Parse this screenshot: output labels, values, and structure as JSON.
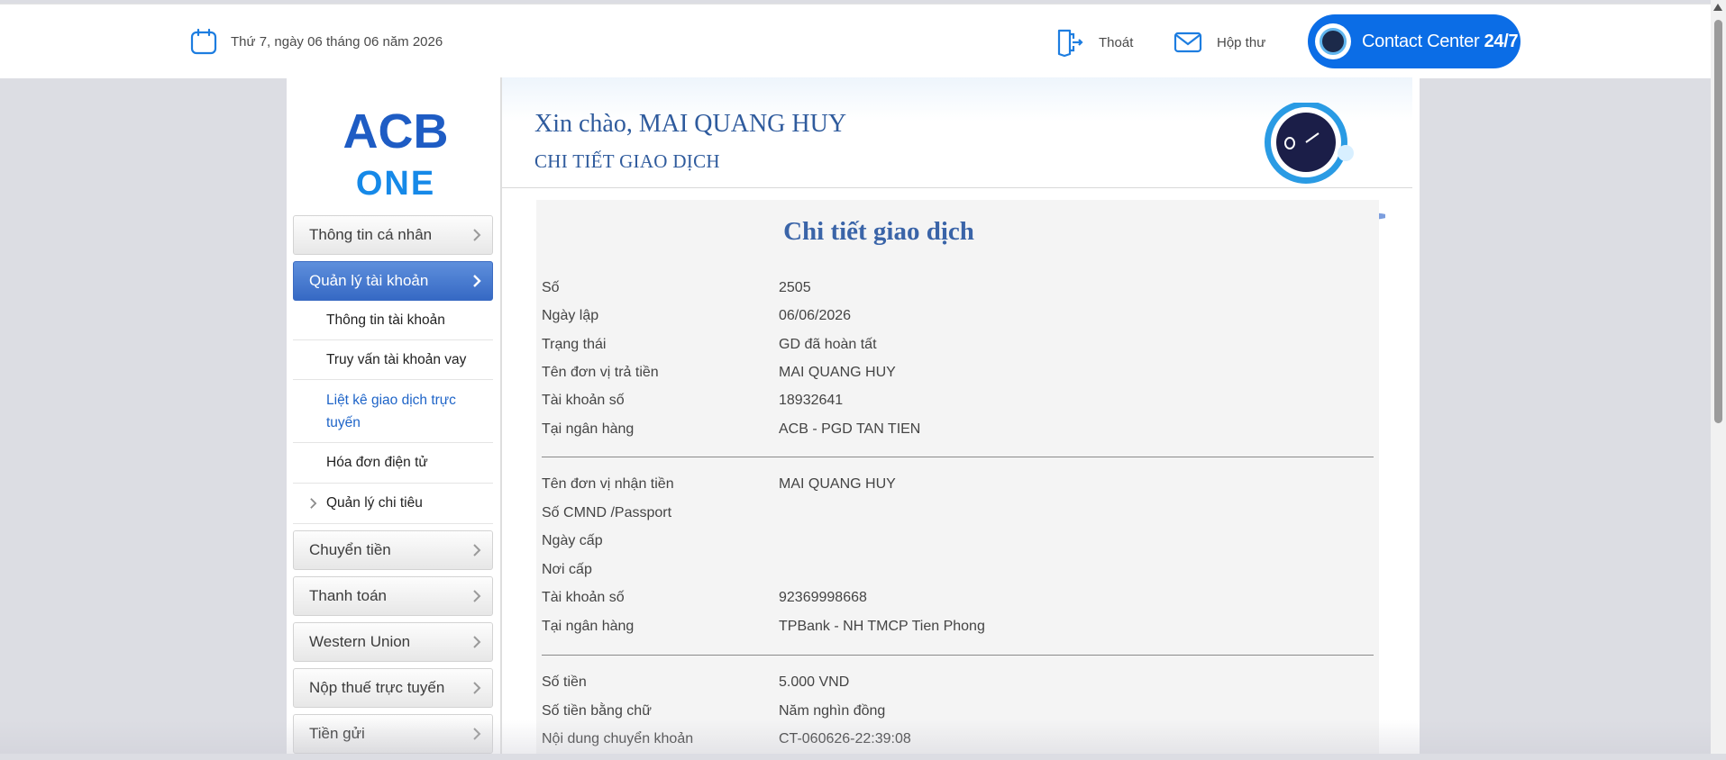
{
  "header": {
    "date": "Thứ 7, ngày 06 tháng 06 năm 2026",
    "logout_label": "Thoát",
    "inbox_label": "Hộp thư",
    "contact_label": "Contact Center",
    "contact_suffix": "24/7",
    "accent_color": "#0b6de6"
  },
  "brand": {
    "line1": "ACB",
    "line2": "ONE"
  },
  "sidebar": {
    "items": [
      {
        "label": "Thông tin cá nhân"
      },
      {
        "label": "Quản lý tài khoản"
      }
    ],
    "subitems": [
      {
        "label": "Thông tin tài khoản"
      },
      {
        "label": "Truy vấn tài khoản vay"
      },
      {
        "label": "Liệt kê giao dịch trực tuyến"
      },
      {
        "label": "Hóa đơn điện tử"
      },
      {
        "label": "Quản lý chi tiêu"
      }
    ],
    "items_after": [
      {
        "label": "Chuyển tiền"
      },
      {
        "label": "Thanh toán"
      },
      {
        "label": "Western Union"
      },
      {
        "label": "Nộp thuế trực tuyến"
      },
      {
        "label": "Tiền gửi"
      }
    ]
  },
  "content": {
    "greeting": "Xin chào, MAI QUANG HUY",
    "section_title": "CHI TIẾT GIAO DỊCH",
    "detail_title": "Chi tiết giao dịch",
    "group1": [
      {
        "k": "Số",
        "v": "2505"
      },
      {
        "k": "Ngày lập",
        "v": "06/06/2026"
      },
      {
        "k": "Trạng thái",
        "v": "GD đã hoàn tất"
      },
      {
        "k": "Tên đơn vị trả tiền",
        "v": "MAI QUANG HUY"
      },
      {
        "k": "Tài khoản số",
        "v": "18932641"
      },
      {
        "k": "Tại ngân hàng",
        "v": "ACB - PGD TAN TIEN"
      }
    ],
    "group2": [
      {
        "k": "Tên đơn vị nhận tiền",
        "v": "MAI QUANG HUY"
      },
      {
        "k": "Số CMND /Passport",
        "v": ""
      },
      {
        "k": "Ngày cấp",
        "v": ""
      },
      {
        "k": "Nơi cấp",
        "v": ""
      },
      {
        "k": "Tài khoản số",
        "v": "92369998668"
      },
      {
        "k": "Tại ngân hàng",
        "v": "TPBank - NH TMCP Tien Phong"
      }
    ],
    "group3": [
      {
        "k": "Số tiền",
        "v": "5.000 VND"
      },
      {
        "k": "Số tiền bằng chữ",
        "v": "Năm nghìn đồng"
      },
      {
        "k": "Nội dung chuyển khoản",
        "v": "CT-060626-22:39:08"
      }
    ]
  }
}
